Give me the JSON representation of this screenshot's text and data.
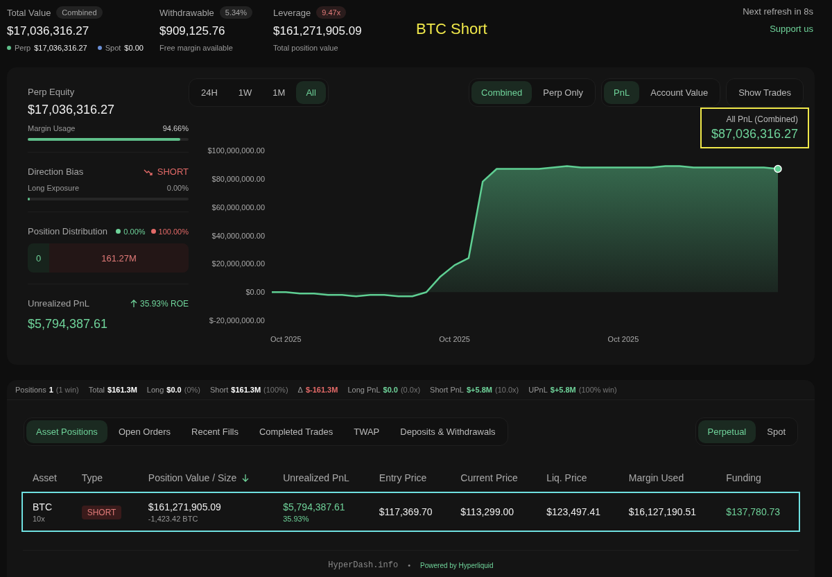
{
  "header": {
    "stats": [
      {
        "label": "Total Value",
        "badge": "Combined",
        "color": "#a5a5a5",
        "value": "$17,036,316.27",
        "breakdown": [
          {
            "label": "Perp",
            "value": "$17,036,316.27",
            "color": "#5fbf8a"
          },
          {
            "label": "Spot",
            "value": "$0.00",
            "color": "#6b8fd6"
          }
        ]
      },
      {
        "label": "Withdrawable",
        "badge": "5.34%",
        "color": "#a5a5a5",
        "value": "$909,125.76",
        "caption": "Free margin available"
      },
      {
        "label": "Leverage",
        "badge": "9.47x",
        "color": "#e07a78",
        "value": "$161,271,905.09",
        "caption": "Total position value"
      }
    ],
    "annotation": "BTC Short",
    "refresh": "Next refresh in 8s",
    "support_link": "Support us"
  },
  "overview": {
    "perp_equity": {
      "label": "Perp Equity",
      "value": "$17,036,316.27",
      "meter_label": "Margin Usage",
      "meter_reading": "94.66%",
      "level": 0.9466
    },
    "direction": {
      "label": "Direction Bias",
      "bias": "SHORT",
      "meter_label": "Long Exposure",
      "meter_reading": "0.00%",
      "level": 0
    },
    "distribution": {
      "label": "Position Distribution",
      "long_pct": "0.00%",
      "short_pct": "100.00%",
      "long_value": "0",
      "short_value": "161.27M"
    },
    "unrealized": {
      "label": "Unrealized PnL",
      "roe": "35.93% ROE",
      "value": "$5,794,387.61"
    }
  },
  "chart_panel": {
    "ranges": [
      {
        "label": "24H",
        "selected": false
      },
      {
        "label": "1W",
        "selected": false
      },
      {
        "label": "1M",
        "selected": false
      },
      {
        "label": "All",
        "selected": true
      }
    ],
    "modes": [
      {
        "label": "Combined",
        "selected": true
      },
      {
        "label": "Perp Only",
        "selected": false
      }
    ],
    "metrics": [
      {
        "label": "PnL",
        "selected": true
      },
      {
        "label": "Account Value",
        "selected": false
      }
    ],
    "show_trades": "Show Trades",
    "summary": {
      "label": "All PnL (Combined)",
      "value": "$87,036,316.27",
      "highlighted": true
    },
    "chart_data": {
      "type": "area",
      "categories": [
        null,
        "Oct 2025",
        null,
        null,
        null,
        null,
        null,
        null,
        null,
        null,
        null,
        null,
        null,
        "Oct 2025",
        null,
        null,
        null,
        null,
        null,
        null,
        null,
        null,
        null,
        null,
        null,
        "Oct 2025",
        null,
        null,
        null,
        null,
        null,
        null,
        null,
        null,
        null,
        null,
        null
      ],
      "series": [
        {
          "color": "#5fcf93",
          "values": [
            0,
            0,
            -1000000,
            -1000000,
            -2000000,
            -2000000,
            -3000000,
            -2000000,
            -2000000,
            -3000000,
            -3000000,
            0,
            11000000,
            19000000,
            24000000,
            78000000,
            87000000,
            87000000,
            87000000,
            87000000,
            88000000,
            89000000,
            88000000,
            88000000,
            88000000,
            88000000,
            88000000,
            88000000,
            89000000,
            89000000,
            88000000,
            88000000,
            88000000,
            88000000,
            88000000,
            88000000,
            87000000
          ]
        }
      ],
      "ylim": [
        -20000000,
        100000000
      ],
      "yticks": [
        {
          "value": -20000000,
          "label": "$-20,000,000.00"
        },
        {
          "value": 0,
          "label": "$0.00"
        },
        {
          "value": 20000000,
          "label": "$20,000,000.00"
        },
        {
          "value": 40000000,
          "label": "$40,000,000.00"
        },
        {
          "value": 60000000,
          "label": "$60,000,000.00"
        },
        {
          "value": 80000000,
          "label": "$80,000,000.00"
        },
        {
          "value": 100000000,
          "label": "$100,000,000.00"
        }
      ]
    }
  },
  "positions": {
    "stats": [
      {
        "label": "Positions",
        "value": "1",
        "note": "(1 win)",
        "color": "#ffffff"
      },
      {
        "label": "Total",
        "value": "$161.3M",
        "color": "#ffffff"
      },
      {
        "label": "Long",
        "value": "$0.0",
        "note": "(0%)",
        "color": "#ffffff"
      },
      {
        "label": "Short",
        "value": "$161.3M",
        "note": "(100%)",
        "color": "#ffffff"
      },
      {
        "label": "Δ",
        "value": "$-161.3M",
        "color": "#e36a68"
      },
      {
        "label": "Long PnL",
        "value": "$0.0",
        "note": "(0.0x)",
        "color": "#6fd39a"
      },
      {
        "label": "Short PnL",
        "value": "$+5.8M",
        "note": "(10.0x)",
        "color": "#6fd39a"
      },
      {
        "label": "UPnL",
        "value": "$+5.8M",
        "note": "(100% win)",
        "color": "#6fd39a"
      }
    ],
    "tabs": [
      {
        "label": "Asset Positions",
        "selected": true
      },
      {
        "label": "Open Orders",
        "selected": false
      },
      {
        "label": "Recent Fills",
        "selected": false
      },
      {
        "label": "Completed Trades",
        "selected": false
      },
      {
        "label": "TWAP",
        "selected": false
      },
      {
        "label": "Deposits & Withdrawals",
        "selected": false
      }
    ],
    "market_tabs": [
      {
        "label": "Perpetual",
        "selected": true
      },
      {
        "label": "Spot",
        "selected": false
      }
    ],
    "table": {
      "columns": [
        {
          "label": "Asset",
          "sorted": false
        },
        {
          "label": "Type",
          "sorted": false
        },
        {
          "label": "Position Value / Size",
          "sorted": true
        },
        {
          "label": "Unrealized PnL",
          "sorted": false
        },
        {
          "label": "Entry Price",
          "sorted": false
        },
        {
          "label": "Current Price",
          "sorted": false
        },
        {
          "label": "Liq. Price",
          "sorted": false
        },
        {
          "label": "Margin Used",
          "sorted": false
        },
        {
          "label": "Funding",
          "sorted": false
        }
      ],
      "rows": [
        {
          "highlighted": true,
          "asset": "BTC",
          "leverage": "10x",
          "type": "SHORT",
          "position_value": "$161,271,905.09",
          "size": "-1,423.42 BTC",
          "upnl": "$5,794,387.61",
          "upnl_pct": "35.93%",
          "entry_price": "$117,369.70",
          "current_price": "$113,299.00",
          "liq_price": "$123,497.41",
          "margin_used": "$16,127,190.51",
          "funding": "$137,780.73"
        }
      ]
    }
  },
  "footer": {
    "site": "HyperDash.info",
    "separator": "•",
    "powered_by": "Powered by Hyperliquid"
  }
}
